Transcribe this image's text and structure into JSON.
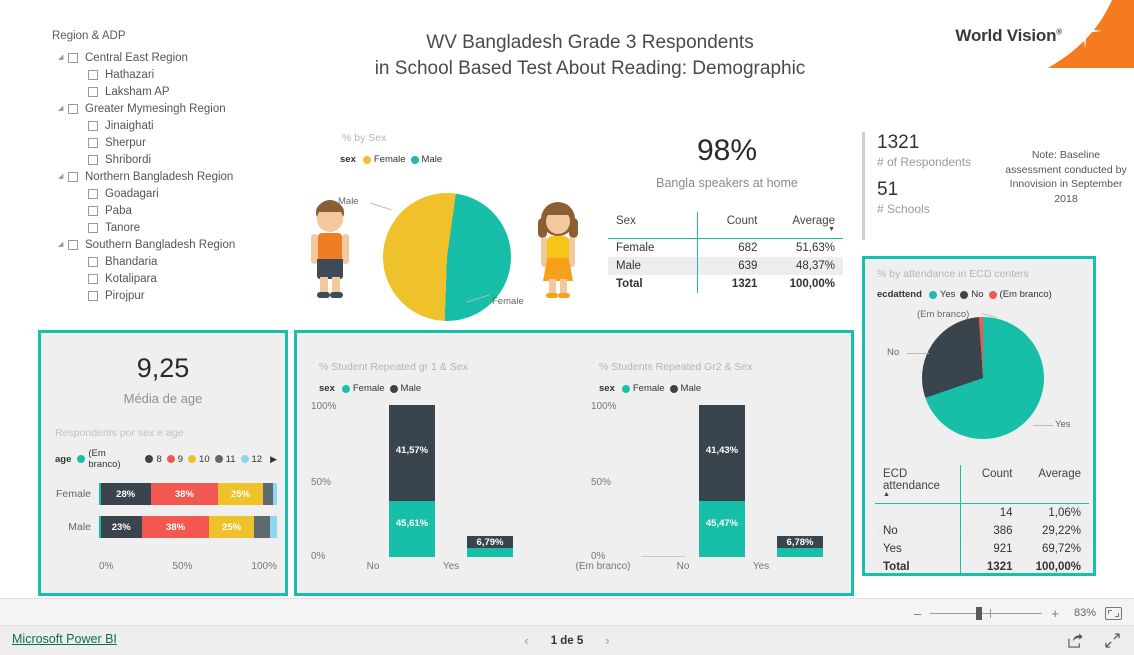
{
  "header": {
    "title_line1": "WV Bangladesh Grade 3 Respondents",
    "title_line2": "in School Based Test About Reading: Demographic",
    "logo_text": "World Vision",
    "logo_mark": "®"
  },
  "slicer": {
    "title": "Region & ADP",
    "nodes": [
      {
        "label": "Central East Region",
        "level": 1,
        "expandable": true
      },
      {
        "label": "Hathazari",
        "level": 2,
        "expandable": false
      },
      {
        "label": "Laksham AP",
        "level": 2,
        "expandable": false
      },
      {
        "label": "Greater Mymesingh Region",
        "level": 1,
        "expandable": true
      },
      {
        "label": "Jinaighati",
        "level": 2,
        "expandable": false
      },
      {
        "label": "Sherpur",
        "level": 2,
        "expandable": false
      },
      {
        "label": "Shribordi",
        "level": 2,
        "expandable": false
      },
      {
        "label": "Northern Bangladesh Region",
        "level": 1,
        "expandable": true
      },
      {
        "label": "Goadagari",
        "level": 2,
        "expandable": false
      },
      {
        "label": "Paba",
        "level": 2,
        "expandable": false
      },
      {
        "label": "Tanore",
        "level": 2,
        "expandable": false
      },
      {
        "label": "Southern Bangladesh Region",
        "level": 1,
        "expandable": true
      },
      {
        "label": "Bhandaria",
        "level": 2,
        "expandable": false
      },
      {
        "label": "Kotalipara",
        "level": 2,
        "expandable": false
      },
      {
        "label": "Pirojpur",
        "level": 2,
        "expandable": false
      }
    ]
  },
  "sex_visual": {
    "title": "% by Sex",
    "legend_name": "sex",
    "callout_male": "Male",
    "callout_female": "Female"
  },
  "kpi_bangla": {
    "value": "98%",
    "label": "Bangla speakers at home"
  },
  "sex_table": {
    "headers": [
      "Sex",
      "Count",
      "Average"
    ],
    "sort_column": "Average",
    "sort_direction": "desc",
    "rows": [
      {
        "sex": "Female",
        "count": "682",
        "average": "51,63%"
      },
      {
        "sex": "Male",
        "count": "639",
        "average": "48,37%"
      }
    ],
    "total": {
      "sex": "Total",
      "count": "1321",
      "average": "100,00%"
    }
  },
  "respondents": {
    "count": "1321",
    "count_label": "# of Respondents",
    "schools": "51",
    "schools_label": "# Schools",
    "note": "Note: Baseline assessment conducted by Innovision in September 2018"
  },
  "ecd": {
    "title": "% by attendance in ECD centers",
    "legend_name": "ecdattend",
    "callout_blank": "(Em branco)",
    "callout_no": "No",
    "callout_yes": "Yes",
    "table": {
      "headers": [
        "ECD attendance",
        "Count",
        "Average"
      ],
      "sort_column": "ECD attendance",
      "sort_direction": "asc",
      "rows": [
        {
          "label": "",
          "count": "14",
          "average": "1,06%"
        },
        {
          "label": "No",
          "count": "386",
          "average": "29,22%"
        },
        {
          "label": "Yes",
          "count": "921",
          "average": "69,72%"
        }
      ],
      "total": {
        "label": "Total",
        "count": "1321",
        "average": "100,00%"
      }
    }
  },
  "age_panel": {
    "kpi_value": "9,25",
    "kpi_label": "Média de age",
    "subtitle": "Respondents por sex e age",
    "legend_name": "age",
    "next_icon": "▶",
    "axis": [
      "0%",
      "50%",
      "100%"
    ]
  },
  "colors": {
    "teal": "#18BFA8",
    "yellow": "#EFC22B",
    "dark": "#3A444C",
    "red": "#F2584F",
    "gray": "#5E6A70",
    "lightblue": "#8ED6EF",
    "orange": "#F47B20",
    "panel_bg": "#EFEFEF",
    "link": "#0F6B5C"
  },
  "chart_data": [
    {
      "type": "pie",
      "name": "sex-pie",
      "title": "% by Sex",
      "legend_title": "sex",
      "categories": [
        "Female",
        "Male"
      ],
      "values": [
        51.63,
        48.37
      ],
      "counts": [
        682,
        639
      ],
      "colors": [
        "#EFC22B",
        "#18BFA8"
      ],
      "legend_position": "top"
    },
    {
      "type": "pie",
      "name": "ecd-pie",
      "title": "% by attendance in ECD centers",
      "legend_title": "ecdattend",
      "categories": [
        "Yes",
        "No",
        "(Em branco)"
      ],
      "values": [
        69.72,
        29.22,
        1.06
      ],
      "counts": [
        921,
        386,
        14
      ],
      "colors": [
        "#18BFA8",
        "#3A444C",
        "#F2584F"
      ],
      "legend_position": "top"
    },
    {
      "type": "bar",
      "name": "age-by-sex-bar",
      "orientation": "horizontal",
      "stacked": true,
      "normalized": true,
      "title": "Respondents por sex e age",
      "legend_title": "age",
      "categories": [
        "Female",
        "Male"
      ],
      "series": [
        {
          "name": "(Em branco)",
          "color": "#18BFA8",
          "values": [
            1,
            1
          ],
          "labels": [
            "",
            ""
          ]
        },
        {
          "name": "8",
          "color": "#3A444C",
          "values": [
            28,
            23
          ],
          "labels": [
            "28%",
            "23%"
          ]
        },
        {
          "name": "9",
          "color": "#F2584F",
          "values": [
            38,
            38
          ],
          "labels": [
            "38%",
            "38%"
          ]
        },
        {
          "name": "10",
          "color": "#EFC22B",
          "values": [
            25,
            25
          ],
          "labels": [
            "25%",
            "25%"
          ]
        },
        {
          "name": "11",
          "color": "#5E6A70",
          "values": [
            6,
            9
          ],
          "labels": [
            "",
            ""
          ]
        },
        {
          "name": "12",
          "color": "#8ED6EF",
          "values": [
            2,
            4
          ],
          "labels": [
            "",
            ""
          ]
        }
      ],
      "xlabel": "",
      "ylabel": "",
      "xlim": [
        0,
        100
      ],
      "xticks": [
        "0%",
        "50%",
        "100%"
      ]
    },
    {
      "type": "bar",
      "name": "repeated-gr1-by-sex",
      "stacked": true,
      "title": "% Student Repeated gr 1 & Sex",
      "legend_title": "sex",
      "categories": [
        "No",
        "Yes"
      ],
      "series": [
        {
          "name": "Female",
          "color": "#18BFA8",
          "values": [
            45.61,
            4.5
          ],
          "labels": [
            "45,61%",
            ""
          ]
        },
        {
          "name": "Male",
          "color": "#3A444C",
          "values": [
            41.57,
            6.79
          ],
          "labels": [
            "41,57%",
            "6,79%"
          ]
        }
      ],
      "ylim": [
        0,
        100
      ],
      "yticks": [
        "0%",
        "50%",
        "100%"
      ],
      "legend_position": "top"
    },
    {
      "type": "bar",
      "name": "repeated-gr2-by-sex",
      "stacked": true,
      "title": "% Students Repeated Gr2 & Sex",
      "legend_title": "sex",
      "categories": [
        "(Em branco)",
        "No",
        "Yes"
      ],
      "series": [
        {
          "name": "Female",
          "color": "#18BFA8",
          "values": [
            0,
            45.47,
            4.5
          ],
          "labels": [
            "",
            "45,47%",
            ""
          ]
        },
        {
          "name": "Male",
          "color": "#3A444C",
          "values": [
            0,
            41.43,
            6.78
          ],
          "labels": [
            "",
            "41,43%",
            "6,78%"
          ]
        }
      ],
      "ylim": [
        0,
        100
      ],
      "yticks": [
        "0%",
        "50%",
        "100%"
      ],
      "legend_position": "top"
    }
  ],
  "charts": {
    "gr1": {
      "title": "% Student Repeated gr 1 & Sex",
      "legend_name": "sex",
      "legend_female": "Female",
      "legend_male": "Male",
      "y_top": "100%",
      "y_mid": "50%",
      "y_zero": "0%",
      "cat_no": "No",
      "cat_yes": "Yes",
      "no_female": "45,61%",
      "no_male": "41,57%",
      "yes_male": "6,79%"
    },
    "gr2": {
      "title": "% Students Repeated Gr2 & Sex",
      "legend_name": "sex",
      "legend_female": "Female",
      "legend_male": "Male",
      "y_top": "100%",
      "y_mid": "50%",
      "y_zero": "0%",
      "cat_blank": "(Em branco)",
      "cat_no": "No",
      "cat_yes": "Yes",
      "no_female": "45,47%",
      "no_male": "41,43%",
      "yes_male": "6,78%"
    }
  },
  "age_legend": [
    {
      "label": "(Em branco)",
      "color": "#18BFA8"
    },
    {
      "label": "8",
      "color": "#3A444C"
    },
    {
      "label": "9",
      "color": "#F2584F"
    },
    {
      "label": "10",
      "color": "#EFC22B"
    },
    {
      "label": "11",
      "color": "#5E6A70"
    },
    {
      "label": "12",
      "color": "#8ED6EF"
    }
  ],
  "zoom_bar": {
    "minus": "–",
    "plus": "+",
    "percent": "83%"
  },
  "footer": {
    "link": "Microsoft Power BI",
    "prev": "‹",
    "page": "1 de 5",
    "next": "›"
  }
}
